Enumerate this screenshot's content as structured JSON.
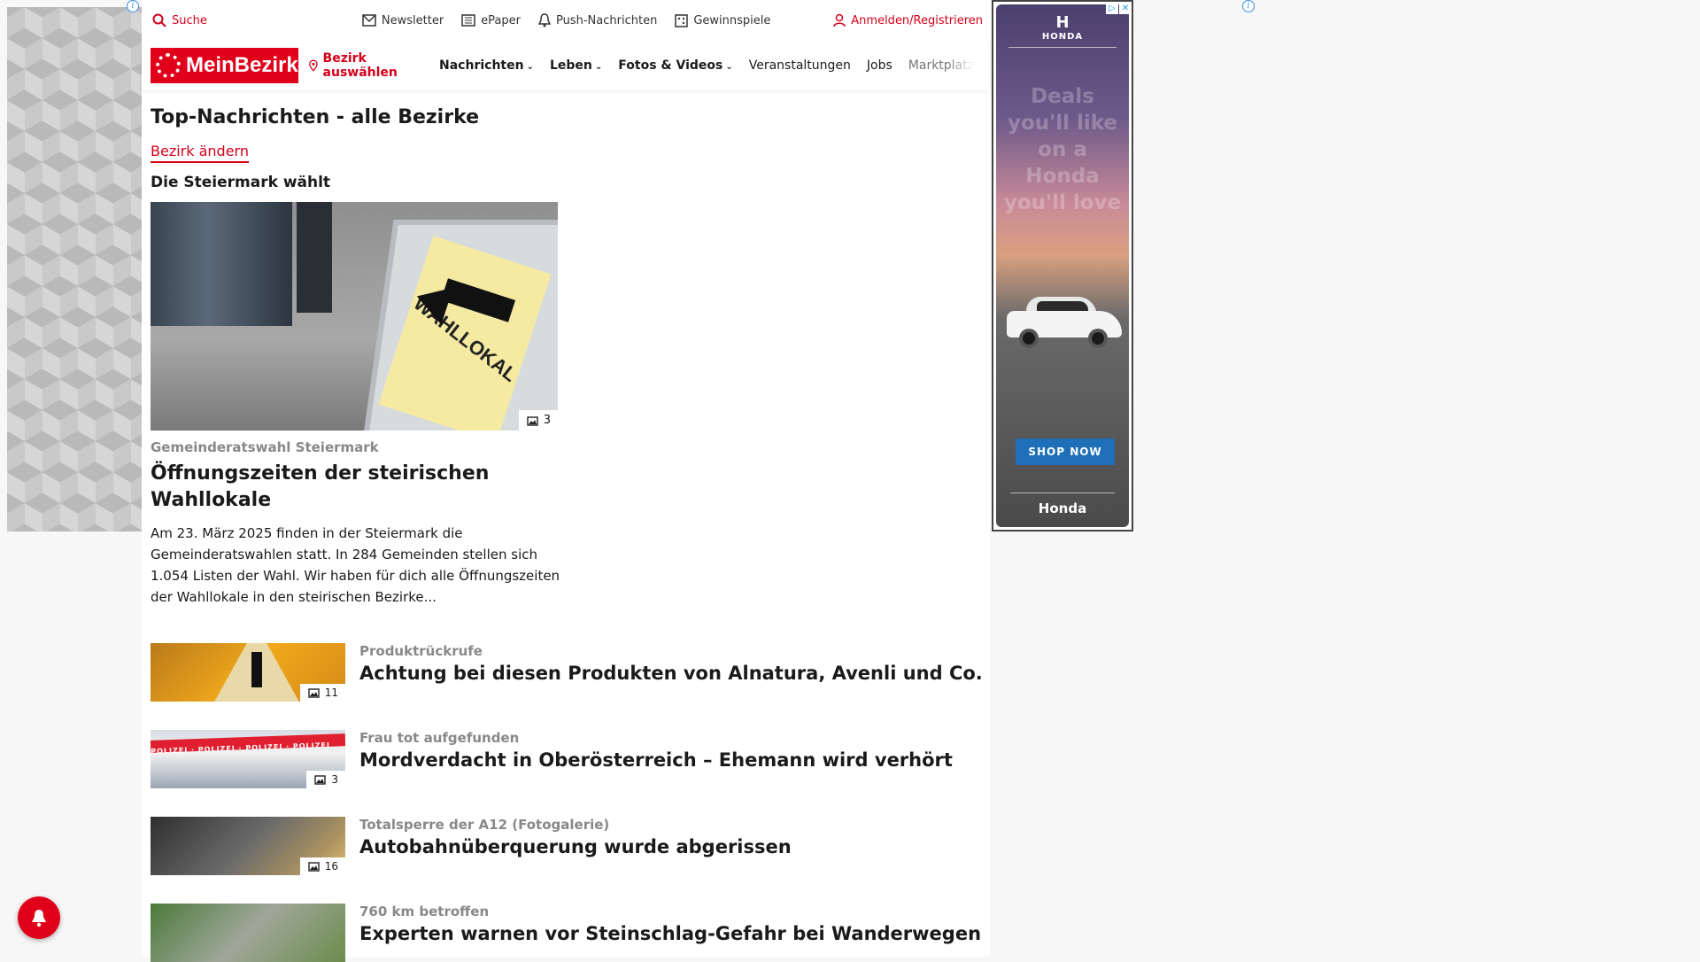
{
  "topbar": {
    "search": "Suche",
    "newsletter": "Newsletter",
    "epaper": "ePaper",
    "push": "Push-Nachrichten",
    "gewinnspiele": "Gewinnspiele",
    "login": "Anmelden/Registrieren"
  },
  "nav": {
    "logo": "MeinBezirk",
    "bezirk": "Bezirk auswählen",
    "items": [
      "Nachrichten",
      "Leben",
      "Fotos & Videos",
      "Veranstaltungen",
      "Jobs",
      "Marktplatz"
    ]
  },
  "page": {
    "title": "Top-Nachrichten - alle Bezirke",
    "change_link": "Bezirk ändern",
    "section": "Die Steiermark wählt"
  },
  "hero": {
    "image_text": "WAHLLOKAL",
    "photo_count": "3",
    "kicker": "Gemeinderatswahl Steiermark",
    "title": "Öffnungszeiten der steirischen Wahllokale",
    "teaser": "Am 23. März 2025 finden in der Steiermark die Gemeinderatswahlen statt. In 284 Gemeinden stellen sich 1.054 Listen der Wahl. Wir haben für dich alle Öffnungszeiten der Wahllokale in den steirischen Bezirke..."
  },
  "articles": [
    {
      "kicker": "Produktrückrufe",
      "title": "Achtung bei diesen Produkten von Alnatura, Avenli und Co.",
      "count": "11"
    },
    {
      "kicker": "Frau tot aufgefunden",
      "title": "Mordverdacht in Oberösterreich – Ehemann wird verhört",
      "count": "3"
    },
    {
      "kicker": "Totalsperre der A12 (Fotogalerie)",
      "title": "Autobahnüberquerung wurde abgerissen",
      "count": "16"
    },
    {
      "kicker": "760 km betroffen",
      "title": "Experten warnen vor Steinschlag-Gefahr bei Wanderwegen",
      "count": ""
    }
  ],
  "ad": {
    "brand_word": "HONDA",
    "headline": "Deals you'll like on a Honda you'll love",
    "cta": "SHOP NOW",
    "footer": "Honda"
  },
  "icons": {
    "search": "search-icon",
    "newsletter": "mail-icon",
    "epaper": "newspaper-icon",
    "push": "bell-icon",
    "gewinnspiele": "gift-icon",
    "login": "user-icon",
    "bezirk": "location-pin-icon"
  },
  "colors": {
    "brand": "#e10019",
    "accent_text": "#d4001a",
    "cta": "#1f6fb8"
  }
}
